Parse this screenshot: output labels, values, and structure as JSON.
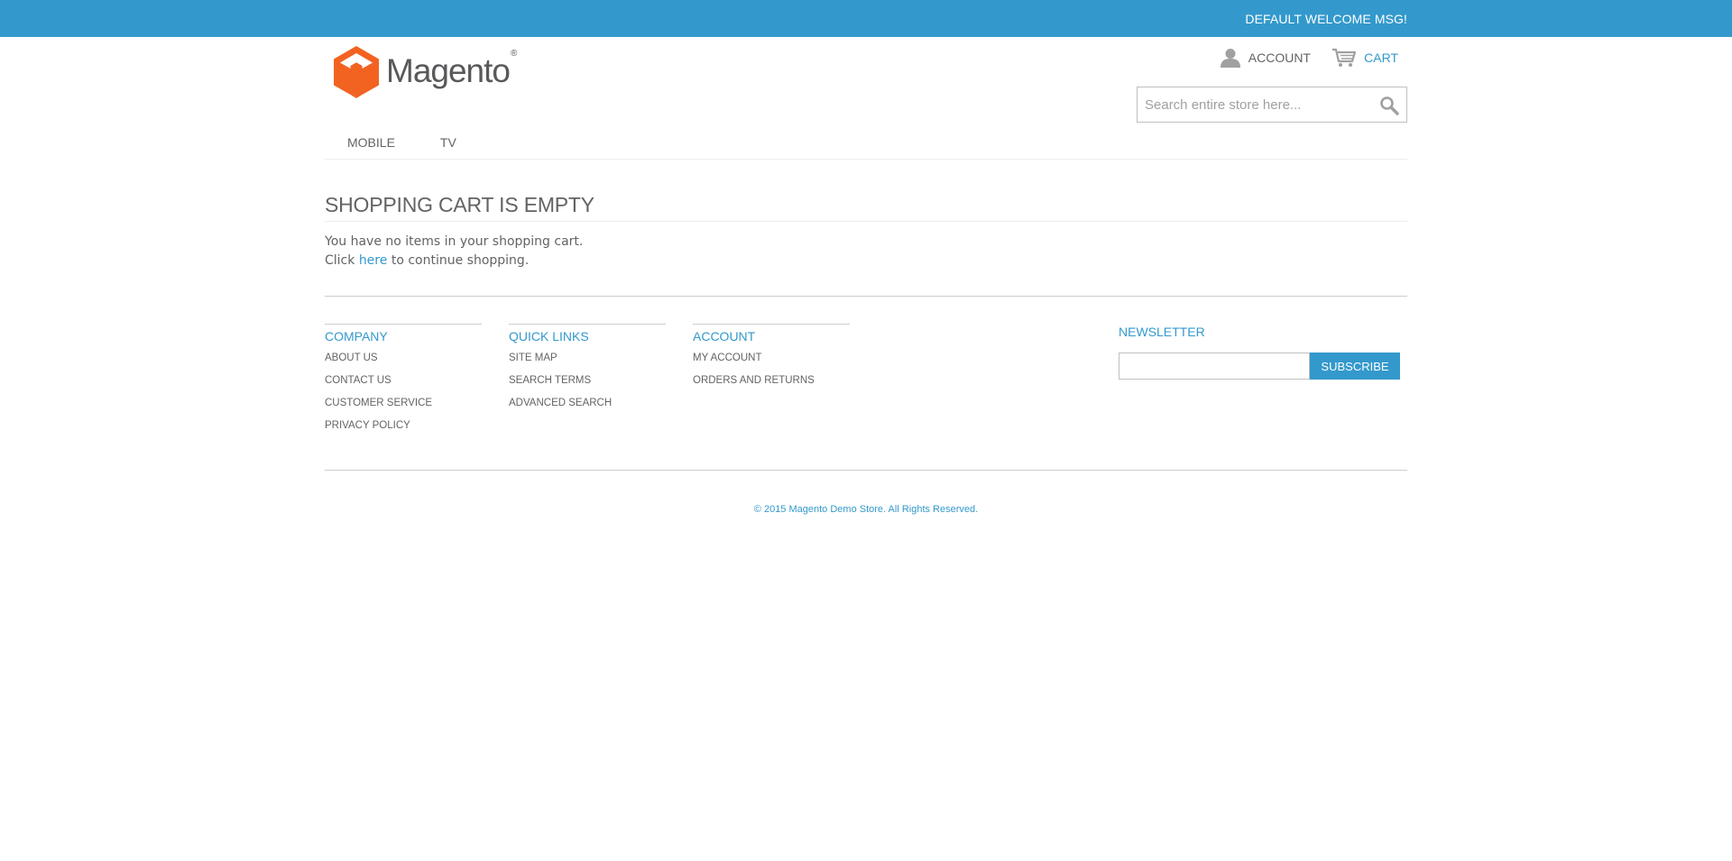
{
  "topbar": {
    "welcome": "DEFAULT WELCOME MSG!"
  },
  "header": {
    "logo_text": "Magento",
    "logo_mark": "®",
    "account_label": "ACCOUNT",
    "cart_label": "CART",
    "search_placeholder": "Search entire store here..."
  },
  "nav": {
    "items": [
      {
        "label": "MOBILE"
      },
      {
        "label": "TV"
      }
    ]
  },
  "main": {
    "title": "SHOPPING CART IS EMPTY",
    "empty_msg": "You have no items in your shopping cart.",
    "click_prefix": "Click",
    "here_link": "here",
    "click_suffix": "to continue shopping."
  },
  "footer": {
    "columns": [
      {
        "title": "COMPANY",
        "links": [
          "ABOUT US",
          "CONTACT US",
          "CUSTOMER SERVICE",
          "PRIVACY POLICY"
        ]
      },
      {
        "title": "QUICK LINKS",
        "links": [
          "SITE MAP",
          "SEARCH TERMS",
          "ADVANCED SEARCH"
        ]
      },
      {
        "title": "ACCOUNT",
        "links": [
          "MY ACCOUNT",
          "ORDERS AND RETURNS"
        ]
      }
    ],
    "newsletter": {
      "title": "NEWSLETTER",
      "value": "",
      "button": "SUBSCRIBE"
    },
    "copyright": "© 2015 Magento Demo Store. All Rights Reserved."
  },
  "colors": {
    "accent": "#3399cc",
    "text": "#636363",
    "logo_orange": "#f26322"
  },
  "icons": {
    "account": "person-icon",
    "cart": "cart-icon",
    "search": "magnifier-icon",
    "logo": "magento-logo-icon"
  }
}
